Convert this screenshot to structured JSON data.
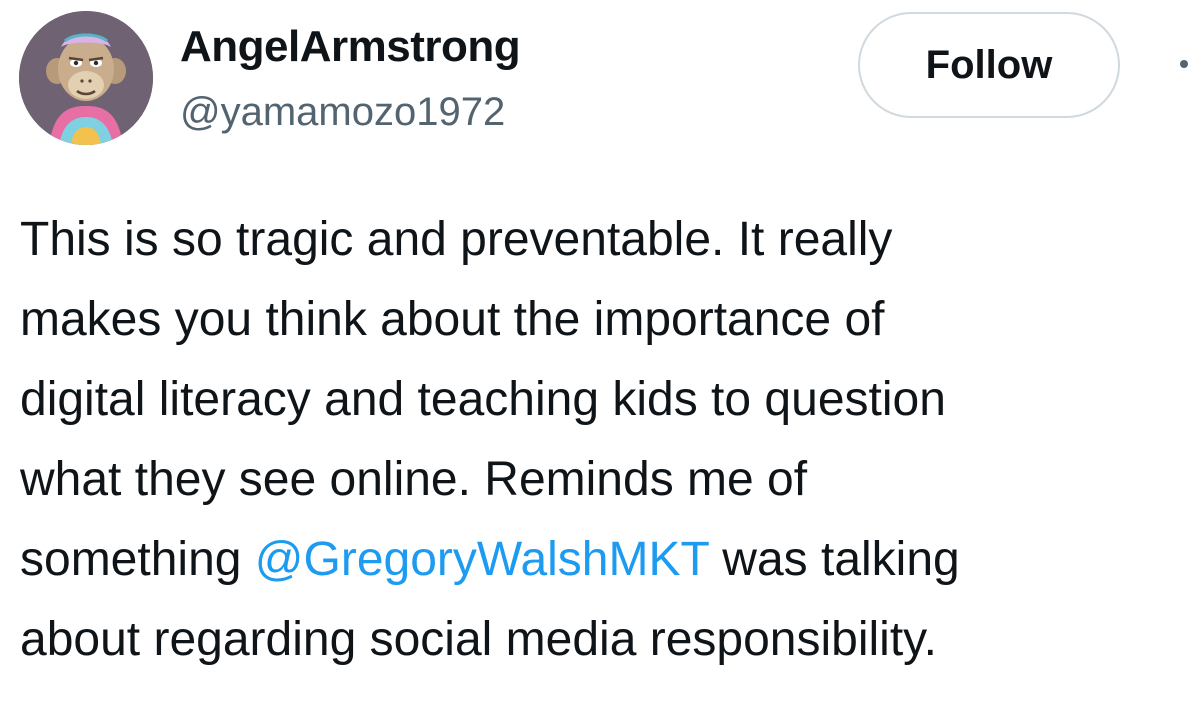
{
  "author": {
    "display_name": "AngelArmstrong",
    "handle": "@yamamozo1972"
  },
  "follow_button": {
    "label": "Follow"
  },
  "tweet": {
    "line1": "This is so tragic and preventable. It really",
    "line2": "makes you think about the importance of",
    "line3": "digital literacy and teaching kids to question",
    "line4": "what they see online. Reminds me of",
    "line5_before": "something ",
    "mention": "@GregoryWalshMKT",
    "line5_after": " was talking",
    "line6": "about regarding social media responsibility."
  },
  "icons": {
    "avatar": "ape-avatar-icon",
    "more": "more-options-icon"
  },
  "colors": {
    "text": "#0f1419",
    "secondary": "#536471",
    "link": "#1d9bf0",
    "border": "#cfd9de"
  }
}
